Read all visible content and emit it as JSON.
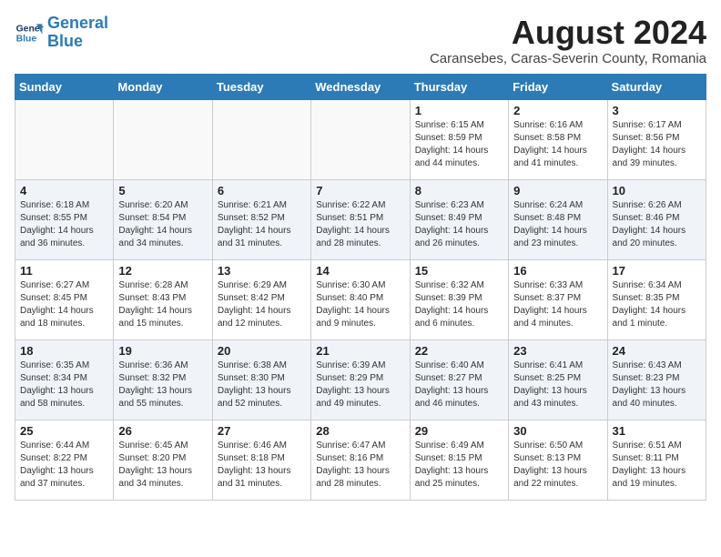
{
  "logo": {
    "line1": "General",
    "line2": "Blue"
  },
  "title": "August 2024",
  "location": "Caransebes, Caras-Severin County, Romania",
  "days_of_week": [
    "Sunday",
    "Monday",
    "Tuesday",
    "Wednesday",
    "Thursday",
    "Friday",
    "Saturday"
  ],
  "weeks": [
    [
      {
        "day": "",
        "info": ""
      },
      {
        "day": "",
        "info": ""
      },
      {
        "day": "",
        "info": ""
      },
      {
        "day": "",
        "info": ""
      },
      {
        "day": "1",
        "info": "Sunrise: 6:15 AM\nSunset: 8:59 PM\nDaylight: 14 hours\nand 44 minutes."
      },
      {
        "day": "2",
        "info": "Sunrise: 6:16 AM\nSunset: 8:58 PM\nDaylight: 14 hours\nand 41 minutes."
      },
      {
        "day": "3",
        "info": "Sunrise: 6:17 AM\nSunset: 8:56 PM\nDaylight: 14 hours\nand 39 minutes."
      }
    ],
    [
      {
        "day": "4",
        "info": "Sunrise: 6:18 AM\nSunset: 8:55 PM\nDaylight: 14 hours\nand 36 minutes."
      },
      {
        "day": "5",
        "info": "Sunrise: 6:20 AM\nSunset: 8:54 PM\nDaylight: 14 hours\nand 34 minutes."
      },
      {
        "day": "6",
        "info": "Sunrise: 6:21 AM\nSunset: 8:52 PM\nDaylight: 14 hours\nand 31 minutes."
      },
      {
        "day": "7",
        "info": "Sunrise: 6:22 AM\nSunset: 8:51 PM\nDaylight: 14 hours\nand 28 minutes."
      },
      {
        "day": "8",
        "info": "Sunrise: 6:23 AM\nSunset: 8:49 PM\nDaylight: 14 hours\nand 26 minutes."
      },
      {
        "day": "9",
        "info": "Sunrise: 6:24 AM\nSunset: 8:48 PM\nDaylight: 14 hours\nand 23 minutes."
      },
      {
        "day": "10",
        "info": "Sunrise: 6:26 AM\nSunset: 8:46 PM\nDaylight: 14 hours\nand 20 minutes."
      }
    ],
    [
      {
        "day": "11",
        "info": "Sunrise: 6:27 AM\nSunset: 8:45 PM\nDaylight: 14 hours\nand 18 minutes."
      },
      {
        "day": "12",
        "info": "Sunrise: 6:28 AM\nSunset: 8:43 PM\nDaylight: 14 hours\nand 15 minutes."
      },
      {
        "day": "13",
        "info": "Sunrise: 6:29 AM\nSunset: 8:42 PM\nDaylight: 14 hours\nand 12 minutes."
      },
      {
        "day": "14",
        "info": "Sunrise: 6:30 AM\nSunset: 8:40 PM\nDaylight: 14 hours\nand 9 minutes."
      },
      {
        "day": "15",
        "info": "Sunrise: 6:32 AM\nSunset: 8:39 PM\nDaylight: 14 hours\nand 6 minutes."
      },
      {
        "day": "16",
        "info": "Sunrise: 6:33 AM\nSunset: 8:37 PM\nDaylight: 14 hours\nand 4 minutes."
      },
      {
        "day": "17",
        "info": "Sunrise: 6:34 AM\nSunset: 8:35 PM\nDaylight: 14 hours\nand 1 minute."
      }
    ],
    [
      {
        "day": "18",
        "info": "Sunrise: 6:35 AM\nSunset: 8:34 PM\nDaylight: 13 hours\nand 58 minutes."
      },
      {
        "day": "19",
        "info": "Sunrise: 6:36 AM\nSunset: 8:32 PM\nDaylight: 13 hours\nand 55 minutes."
      },
      {
        "day": "20",
        "info": "Sunrise: 6:38 AM\nSunset: 8:30 PM\nDaylight: 13 hours\nand 52 minutes."
      },
      {
        "day": "21",
        "info": "Sunrise: 6:39 AM\nSunset: 8:29 PM\nDaylight: 13 hours\nand 49 minutes."
      },
      {
        "day": "22",
        "info": "Sunrise: 6:40 AM\nSunset: 8:27 PM\nDaylight: 13 hours\nand 46 minutes."
      },
      {
        "day": "23",
        "info": "Sunrise: 6:41 AM\nSunset: 8:25 PM\nDaylight: 13 hours\nand 43 minutes."
      },
      {
        "day": "24",
        "info": "Sunrise: 6:43 AM\nSunset: 8:23 PM\nDaylight: 13 hours\nand 40 minutes."
      }
    ],
    [
      {
        "day": "25",
        "info": "Sunrise: 6:44 AM\nSunset: 8:22 PM\nDaylight: 13 hours\nand 37 minutes."
      },
      {
        "day": "26",
        "info": "Sunrise: 6:45 AM\nSunset: 8:20 PM\nDaylight: 13 hours\nand 34 minutes."
      },
      {
        "day": "27",
        "info": "Sunrise: 6:46 AM\nSunset: 8:18 PM\nDaylight: 13 hours\nand 31 minutes."
      },
      {
        "day": "28",
        "info": "Sunrise: 6:47 AM\nSunset: 8:16 PM\nDaylight: 13 hours\nand 28 minutes."
      },
      {
        "day": "29",
        "info": "Sunrise: 6:49 AM\nSunset: 8:15 PM\nDaylight: 13 hours\nand 25 minutes."
      },
      {
        "day": "30",
        "info": "Sunrise: 6:50 AM\nSunset: 8:13 PM\nDaylight: 13 hours\nand 22 minutes."
      },
      {
        "day": "31",
        "info": "Sunrise: 6:51 AM\nSunset: 8:11 PM\nDaylight: 13 hours\nand 19 minutes."
      }
    ]
  ]
}
